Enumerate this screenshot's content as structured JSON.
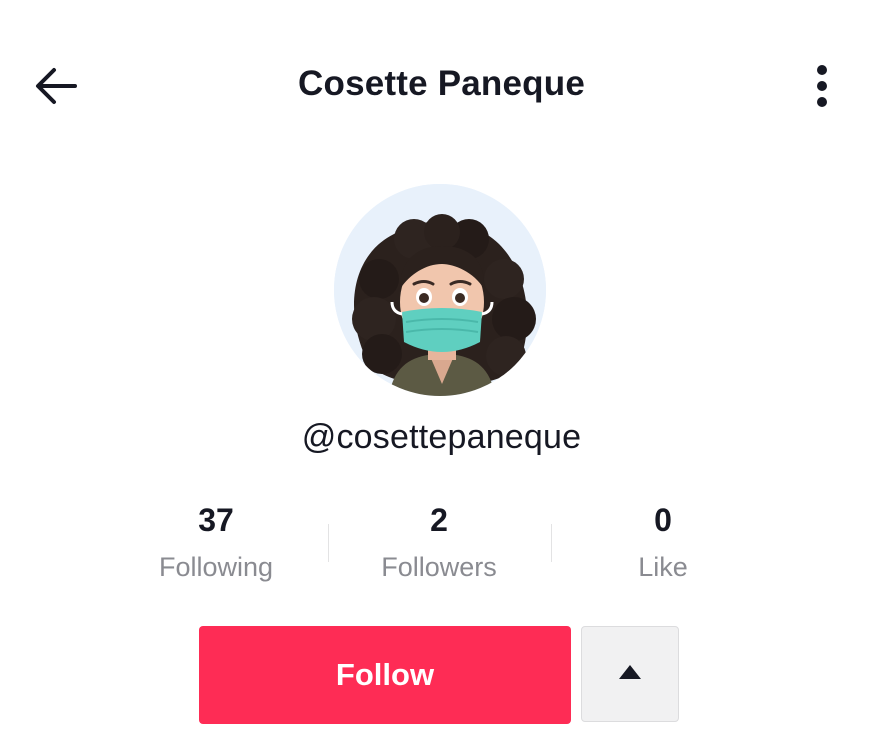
{
  "header": {
    "back_icon": "arrow-left-icon",
    "title": "Cosette Paneque",
    "more_icon": "more-vertical-icon"
  },
  "profile": {
    "avatar": "avatar-image",
    "handle": "@cosettepaneque"
  },
  "stats": [
    {
      "value": "37",
      "label": "Following"
    },
    {
      "value": "2",
      "label": "Followers"
    },
    {
      "value": "0",
      "label": "Like"
    }
  ],
  "actions": {
    "follow_label": "Follow",
    "suggest_icon": "triangle-up-icon"
  },
  "colors": {
    "accent": "#fe2c55",
    "text_primary": "#161823",
    "text_secondary": "#8a8b91",
    "secondary_button_bg": "#f1f1f2"
  }
}
